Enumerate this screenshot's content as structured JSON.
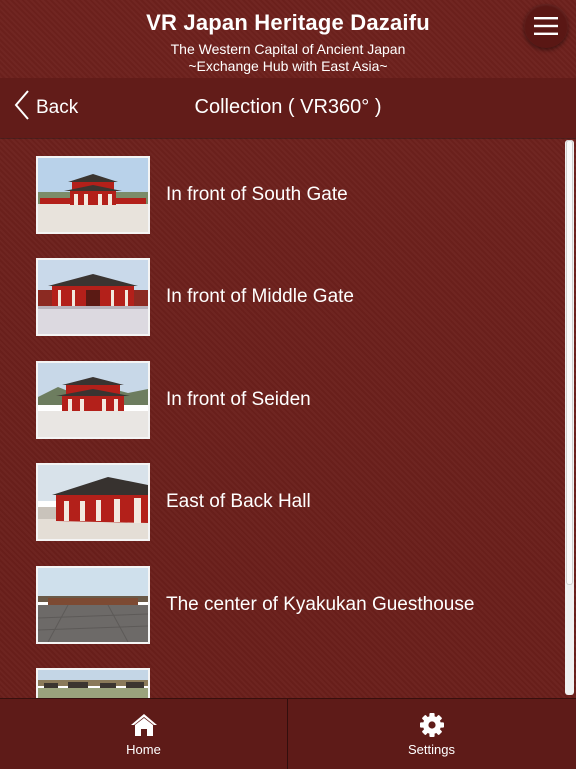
{
  "header": {
    "title": "VR Japan Heritage Dazaifu",
    "subtitle_line1": "The Western Capital of Ancient Japan",
    "subtitle_line2": "~Exchange Hub with East Asia~",
    "menu_icon": "hamburger-menu-icon"
  },
  "navbar": {
    "back_label": "Back",
    "title": "Collection ( VR360° )"
  },
  "collection": {
    "items": [
      {
        "label": "In front of South Gate",
        "thumb": "gate-front"
      },
      {
        "label": "In front of Middle Gate",
        "thumb": "gate-wide"
      },
      {
        "label": "In front of Seiden",
        "thumb": "hall-front"
      },
      {
        "label": "East of Back Hall",
        "thumb": "hall-side"
      },
      {
        "label": "The center of Kyakukan Guesthouse",
        "thumb": "courtyard"
      },
      {
        "label": "",
        "thumb": "town-view"
      }
    ]
  },
  "tabbar": {
    "home_label": "Home",
    "settings_label": "Settings"
  },
  "colors": {
    "background": "#6b1f1c",
    "navbar": "#621c19",
    "tabbar": "#5e1b18",
    "building_red": "#b3201a",
    "text": "#ffffff"
  }
}
